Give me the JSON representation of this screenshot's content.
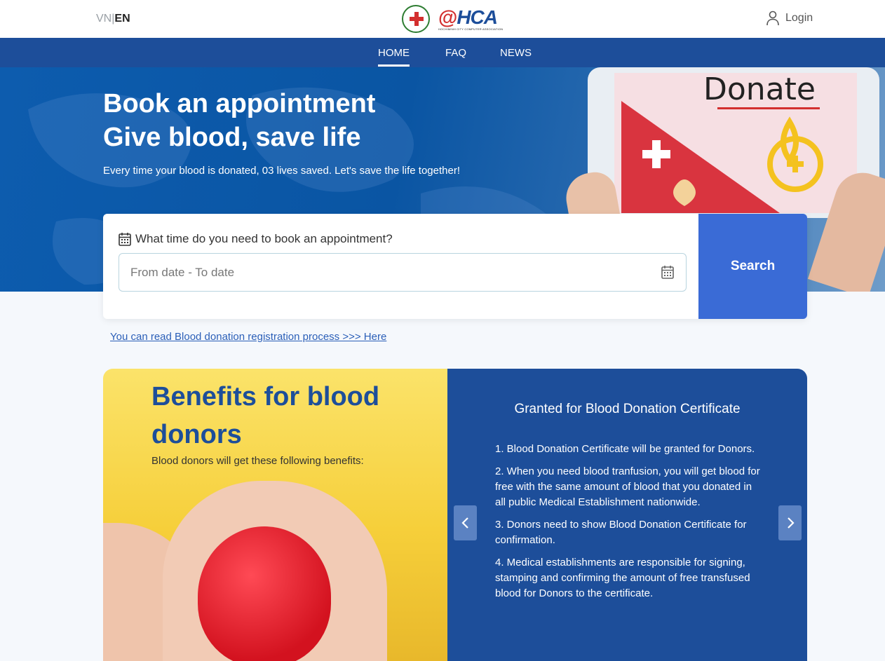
{
  "header": {
    "lang_vn": "VN",
    "lang_sep": "|",
    "lang_en": "EN",
    "logo_mark_at": "@",
    "logo_mark_text": "HCA",
    "logo_sub": "HOCHIMINH CITY COMPUTER ASSOCIATION",
    "login_label": "Login"
  },
  "nav": {
    "items": [
      {
        "label": "HOME",
        "active": true
      },
      {
        "label": "FAQ",
        "active": false
      },
      {
        "label": "NEWS",
        "active": false
      }
    ]
  },
  "hero": {
    "title_line1": "Book an appointment",
    "title_line2": "Give blood, save life",
    "tagline": "Every time your blood is donated, 03 lives saved. Let's save the life together!",
    "image_word": "Donate"
  },
  "search": {
    "label": "What time do you need to book an appointment?",
    "placeholder": "From date - To date",
    "button_label": "Search"
  },
  "process_link": "You can read Blood donation registration process >>> Here",
  "benefits": {
    "title": "Benefits for blood donors",
    "subtitle": "Blood donors will get these following benefits:"
  },
  "certificate": {
    "title": "Granted for Blood Donation Certificate",
    "items": [
      "1. Blood Donation Certificate will be granted for Donors.",
      "2. When you need blood tranfusion, you will get blood for free with the same amount of blood that you donated in all public Medical Establishment nationwide.",
      "3. Donors need to show Blood Donation Certificate for confirmation.",
      "4. Medical establishments are responsible for signing, stamping and confirming the amount of free transfused blood for Donors to the certificate."
    ]
  },
  "colors": {
    "primary": "#1d4e9a",
    "search_button": "#3a6bd6",
    "benefits_bg": "#f6cf3a",
    "link": "#2b5fb8"
  },
  "icons": [
    "user-icon",
    "calendar-icon",
    "chevron-left-icon",
    "chevron-right-icon",
    "red-cross-logo"
  ]
}
